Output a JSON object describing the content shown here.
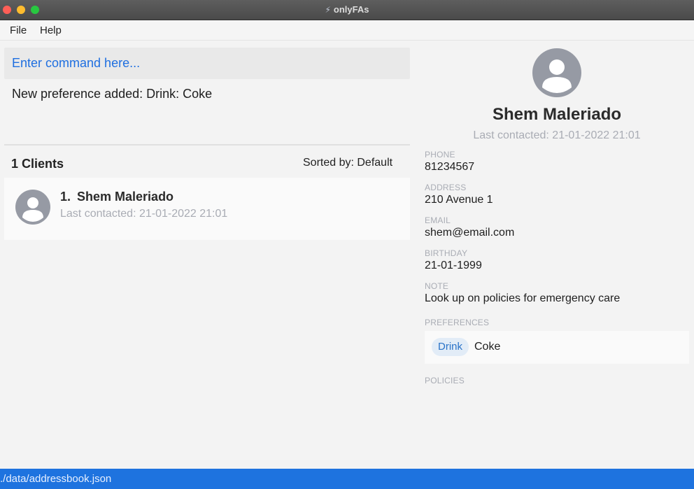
{
  "window": {
    "title": "onlyFAs",
    "colors": {
      "close": "#ff5f57",
      "minimize": "#febc2e",
      "maximize": "#28c840"
    }
  },
  "menu": {
    "items": [
      "File",
      "Help"
    ]
  },
  "command": {
    "placeholder": "Enter command here...",
    "value": ""
  },
  "result": {
    "message": "New preference added: Drink: Coke"
  },
  "client_list": {
    "count_label": "1 Clients",
    "sort_label": "Sorted by: Default",
    "items": [
      {
        "index": "1.",
        "name": "Shem Maleriado",
        "last_contacted": "Last contacted: 21-01-2022 21:01"
      }
    ]
  },
  "detail": {
    "name": "Shem Maleriado",
    "last_contacted": "Last contacted: 21-01-2022 21:01",
    "phone_label": "PHONE",
    "phone": "81234567",
    "address_label": "ADDRESS",
    "address": "210 Avenue 1",
    "email_label": "EMAIL",
    "email": "shem@email.com",
    "birthday_label": "BIRTHDAY",
    "birthday": "21-01-1999",
    "note_label": "NOTE",
    "note": "Look up on policies for emergency care",
    "preferences_label": "PREFERENCES",
    "preferences": [
      {
        "category": "Drink",
        "value": "Coke"
      }
    ],
    "policies_label": "POLICIES"
  },
  "status_bar": {
    "path": "./data/addressbook.json"
  },
  "theme": {
    "accent": "#1e73df",
    "muted_text": "#a9acb4",
    "tag_bg": "#e2ecf7",
    "tag_text": "#2a73c8"
  }
}
